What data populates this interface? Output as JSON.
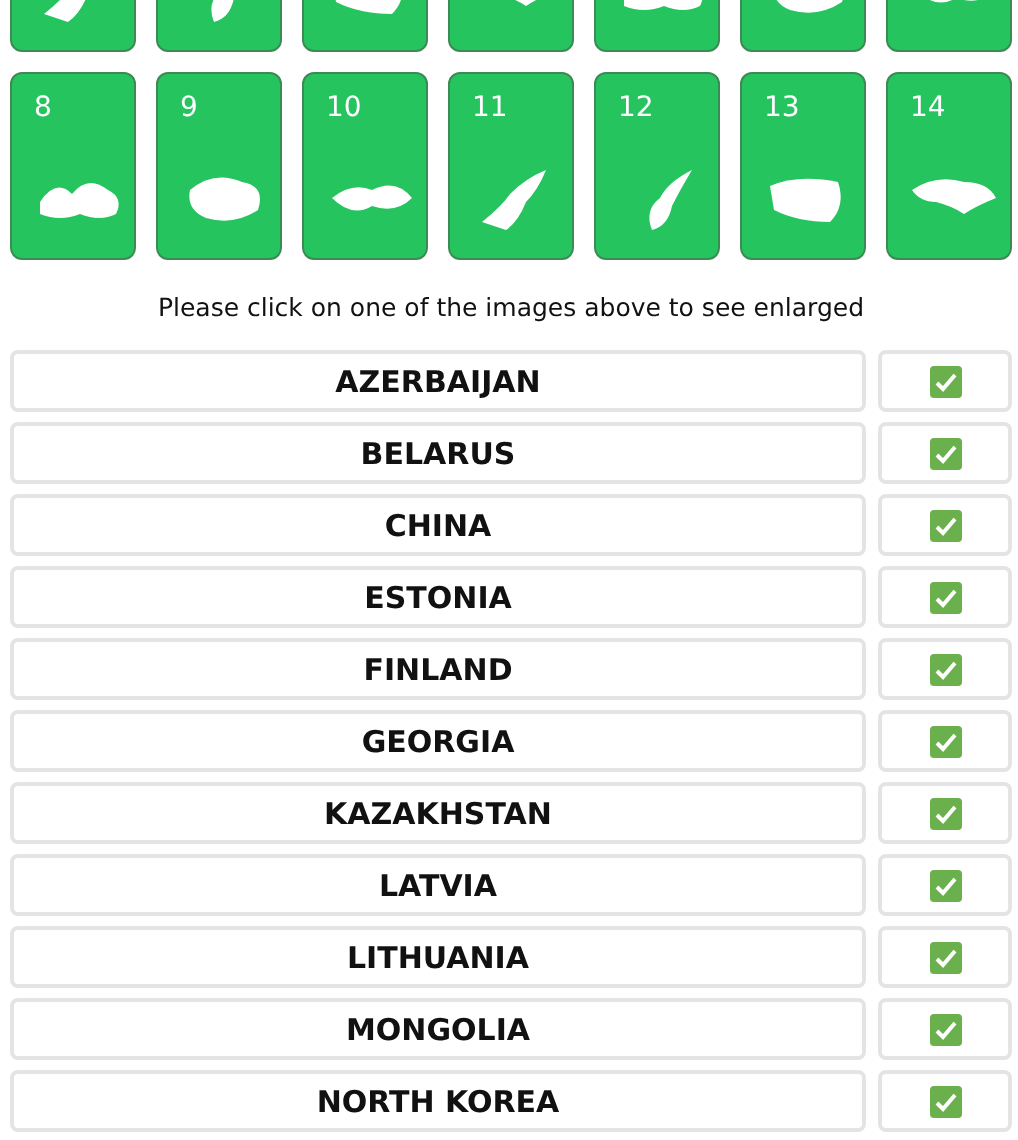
{
  "tiles_top": [
    {
      "solved": true
    },
    {
      "solved": true
    },
    {
      "solved": true
    },
    {
      "solved": true
    },
    {
      "solved": true
    },
    {
      "solved": true
    },
    {
      "solved": true
    }
  ],
  "tiles": [
    {
      "number": "8",
      "solved": true
    },
    {
      "number": "9",
      "solved": true
    },
    {
      "number": "10",
      "solved": true
    },
    {
      "number": "11",
      "solved": true
    },
    {
      "number": "12",
      "solved": true
    },
    {
      "number": "13",
      "solved": true
    },
    {
      "number": "14",
      "solved": true
    }
  ],
  "hint": "Please click on one of the images above to see enlarged",
  "answers": [
    {
      "name": "AZERBAIJAN",
      "checked": true
    },
    {
      "name": "BELARUS",
      "checked": true
    },
    {
      "name": "CHINA",
      "checked": true
    },
    {
      "name": "ESTONIA",
      "checked": true
    },
    {
      "name": "FINLAND",
      "checked": true
    },
    {
      "name": "GEORGIA",
      "checked": true
    },
    {
      "name": "KAZAKHSTAN",
      "checked": true
    },
    {
      "name": "LATVIA",
      "checked": true
    },
    {
      "name": "LITHUANIA",
      "checked": true
    },
    {
      "name": "MONGOLIA",
      "checked": true
    },
    {
      "name": "NORTH KOREA",
      "checked": true
    }
  ]
}
